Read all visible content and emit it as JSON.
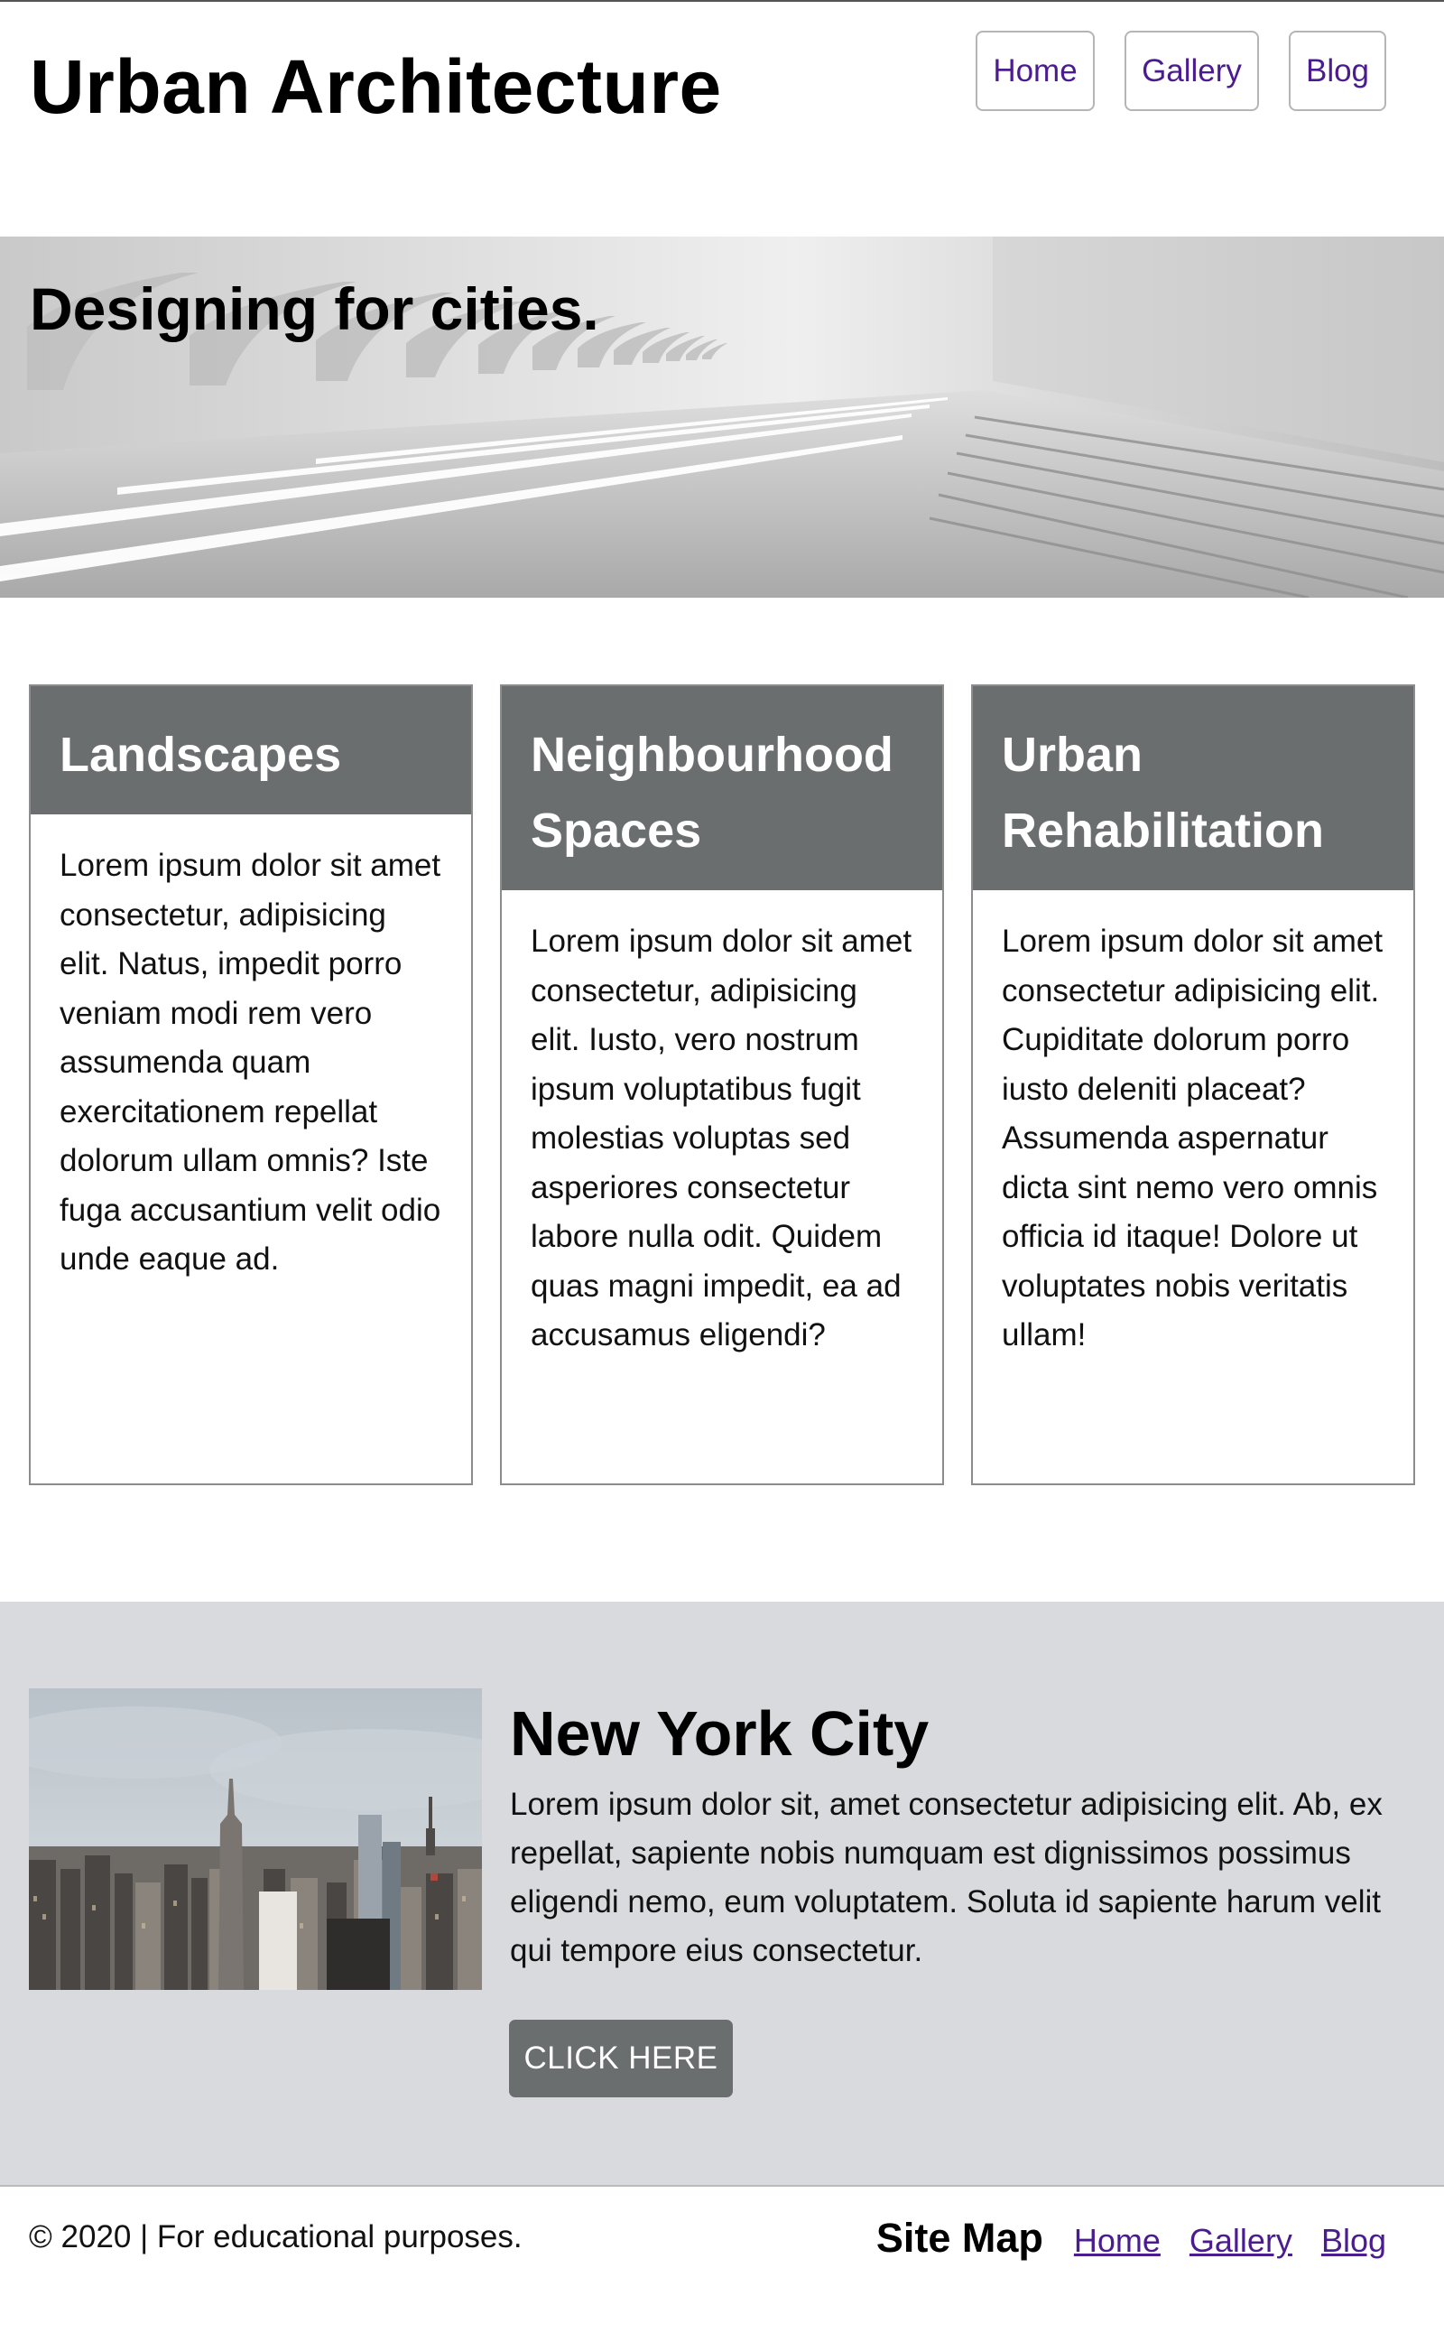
{
  "header": {
    "title": "Urban Architecture",
    "nav": [
      "Home",
      "Gallery",
      "Blog"
    ]
  },
  "hero": {
    "title": "Designing for cities."
  },
  "cards": [
    {
      "title": "Landscapes",
      "text": "Lorem ipsum dolor sit amet consectetur, adipisicing elit. Natus, impedit porro veniam modi rem vero assumenda quam exercitationem repellat dolorum ullam omnis? Iste fuga accusantium velit odio unde eaque ad."
    },
    {
      "title": "Neighbourhood Spaces",
      "text": "Lorem ipsum dolor sit amet consectetur, adipisicing elit. Iusto, vero nostrum ipsum voluptatibus fugit molestias voluptas sed asperiores consectetur labore nulla odit. Quidem quas magni impedit, ea ad accusamus eligendi?"
    },
    {
      "title": "Urban Rehabilitation",
      "text": "Lorem ipsum dolor sit amet consectetur adipisicing elit. Cupiditate dolorum porro iusto deleniti placeat? Assumenda aspernatur dicta sint nemo vero omnis officia id itaque! Dolore ut voluptates nobis veritatis ullam!"
    }
  ],
  "feature": {
    "title": "New York City",
    "text": "Lorem ipsum dolor sit, amet consectetur adipisicing elit. Ab, ex repellat, sapiente nobis numquam est dignissimos possimus eligendi nemo, eum voluptatem. Soluta id sapiente harum velit qui tempore eius consectetur.",
    "button": "CLICK HERE"
  },
  "footer": {
    "copyright": "© 2020 | For educational purposes.",
    "sitemap_title": "Site Map",
    "links": [
      "Home",
      "Gallery",
      "Blog"
    ]
  },
  "colors": {
    "nav_link": "#4b1c8f",
    "card_header": "#6b6e6e",
    "feature_bg": "#d9dadd"
  }
}
